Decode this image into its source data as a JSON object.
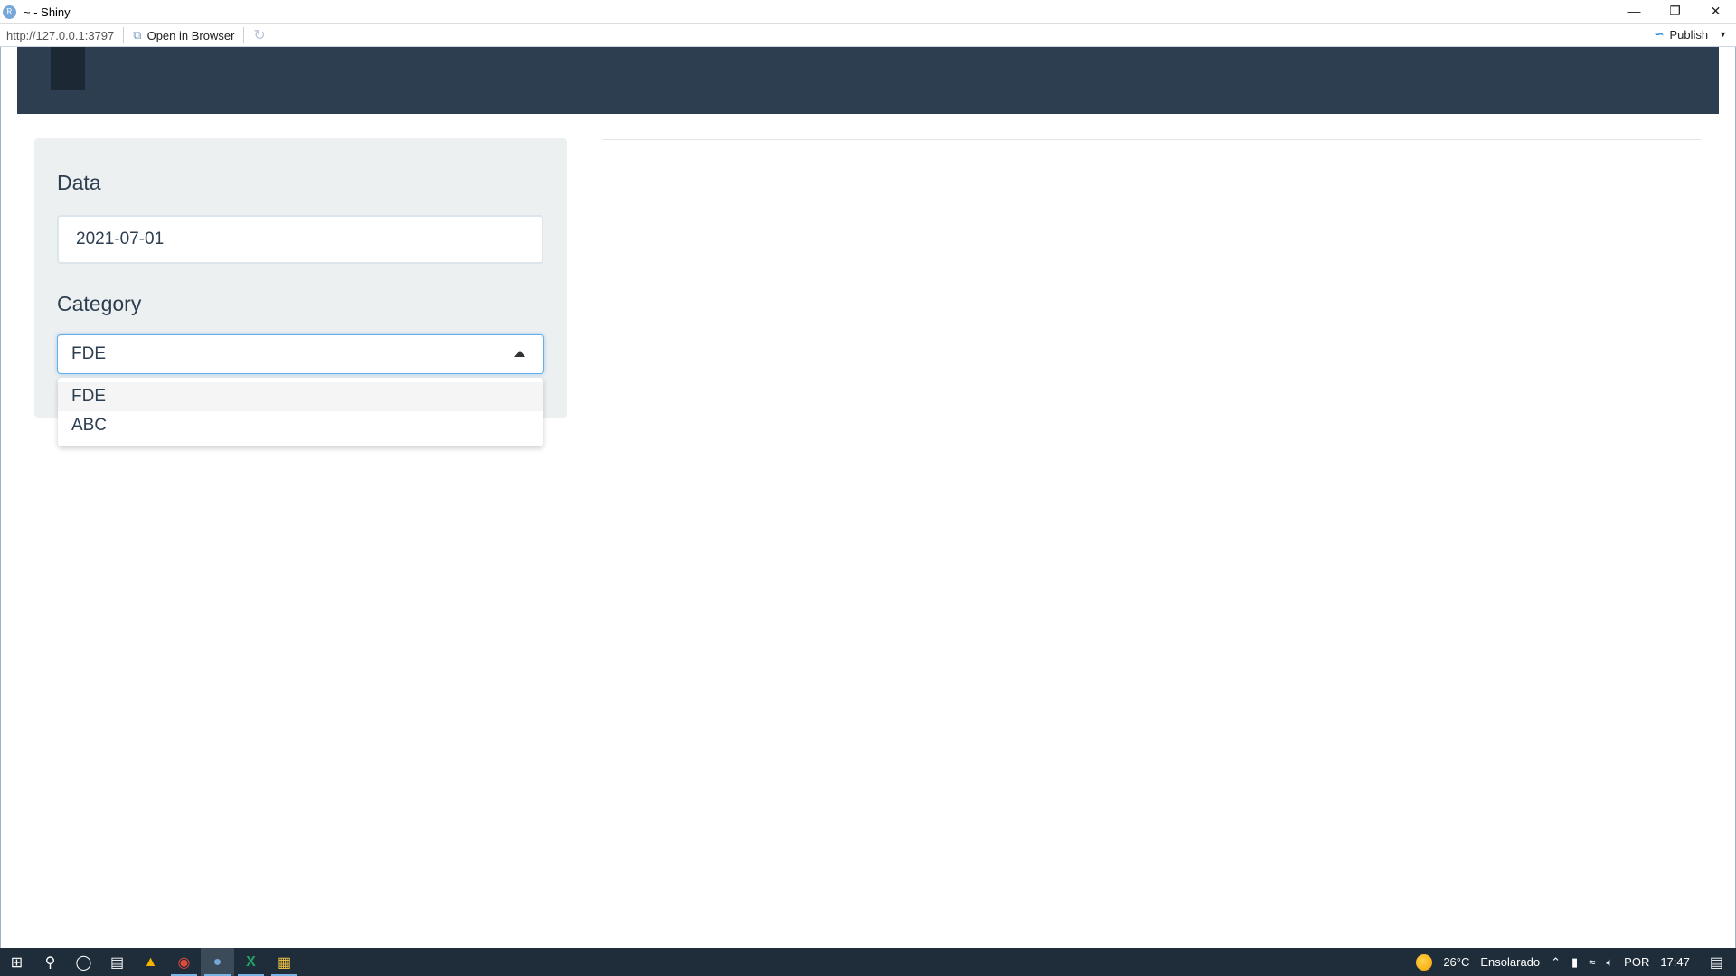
{
  "window": {
    "title": "~ - Shiny",
    "logo": "R",
    "controls": [
      "minimize-icon",
      "restore-icon",
      "close-icon"
    ]
  },
  "toolbar": {
    "url": "http://127.0.0.1:3797",
    "open_in_browser": "Open in Browser",
    "publish": "Publish"
  },
  "sidebar": {
    "date_label": "Data",
    "date_value": "2021-07-01",
    "category_label": "Category",
    "category_value": "FDE",
    "category_options": [
      "FDE",
      "ABC"
    ]
  },
  "taskbar": {
    "weather_temp": "26°C",
    "weather_text": "Ensolarado",
    "language": "POR",
    "time": "17:47"
  },
  "colors": {
    "navbar": "#2c3e50",
    "panel": "#ecf0f1",
    "focus": "#66afe9",
    "taskbar": "#1f2d3a"
  }
}
